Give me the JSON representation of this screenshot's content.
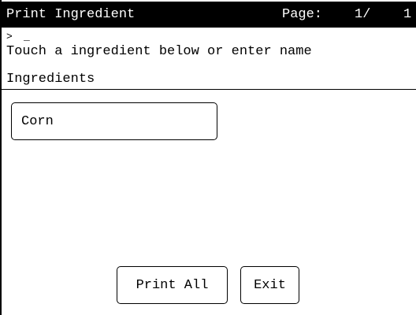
{
  "title_bar": {
    "title": "Print Ingredient",
    "page_label": "Page:",
    "page_number": "1/",
    "page_total": "1"
  },
  "prompt": {
    "caret": ">",
    "cursor": "_"
  },
  "instruction": "Touch a ingredient below or enter name",
  "section": {
    "header": "Ingredients"
  },
  "ingredients": [
    {
      "label": "Corn"
    }
  ],
  "buttons": {
    "print_all": "Print All",
    "exit": "Exit"
  }
}
